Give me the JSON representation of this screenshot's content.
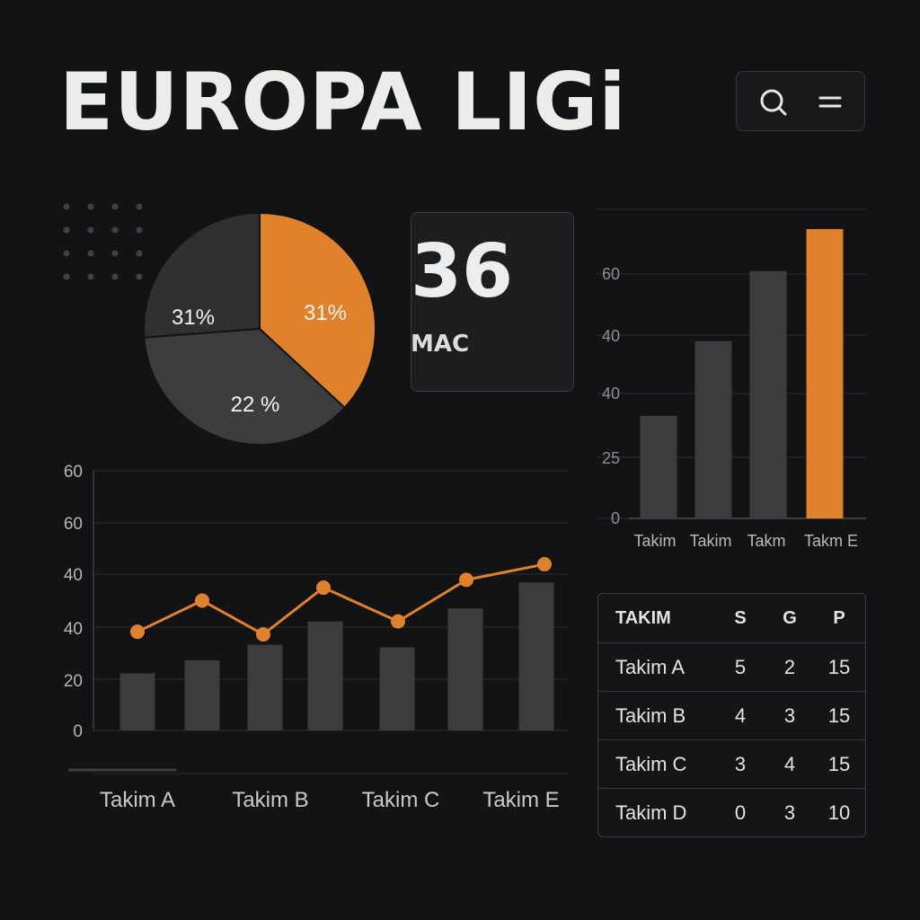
{
  "header": {
    "title": "EUROPA LIGi",
    "search_icon": "search-icon",
    "menu_icon": "menu-icon"
  },
  "colors": {
    "background": "#111315",
    "accent": "#e0822c",
    "bar": "#3a3c3e",
    "slice_dark": "#3b3d3f",
    "slice_mid": "#2e3032"
  },
  "kpi": {
    "value": "36",
    "label": "MAC"
  },
  "chart_data": [
    {
      "type": "pie",
      "labels": [
        "31%",
        "31%",
        "22 %"
      ],
      "values": [
        31,
        31,
        22
      ],
      "colors": [
        "#e0822c",
        "#3b3d3f",
        "#2e3032"
      ]
    },
    {
      "type": "bar",
      "categories": [
        "Takim",
        "Takim",
        "Takm",
        "Takm E"
      ],
      "values": [
        22,
        38,
        53,
        62
      ],
      "highlight_index": 3,
      "ytick_labels": [
        "0",
        "25",
        "40",
        "40",
        "60"
      ],
      "ylim": [
        0,
        70
      ],
      "grid": true
    },
    {
      "type": "bar+line",
      "categories": [
        "Takim A",
        "Takim B",
        "Takim C",
        "Takim E"
      ],
      "bars": [
        22,
        27,
        33,
        42,
        32,
        47,
        57
      ],
      "line": [
        38,
        50,
        37,
        55,
        42,
        58,
        64
      ],
      "ytick_labels": [
        "0",
        "20",
        "40",
        "40",
        "60",
        "60"
      ],
      "ylim": [
        0,
        100
      ],
      "grid": true
    }
  ],
  "table": {
    "headers": [
      "TAKIM",
      "S",
      "G",
      "P"
    ],
    "rows": [
      [
        "Takim A",
        "5",
        "2",
        "15"
      ],
      [
        "Takim B",
        "4",
        "3",
        "15"
      ],
      [
        "Takim C",
        "3",
        "4",
        "15"
      ],
      [
        "Takim D",
        "0",
        "3",
        "10"
      ]
    ]
  }
}
